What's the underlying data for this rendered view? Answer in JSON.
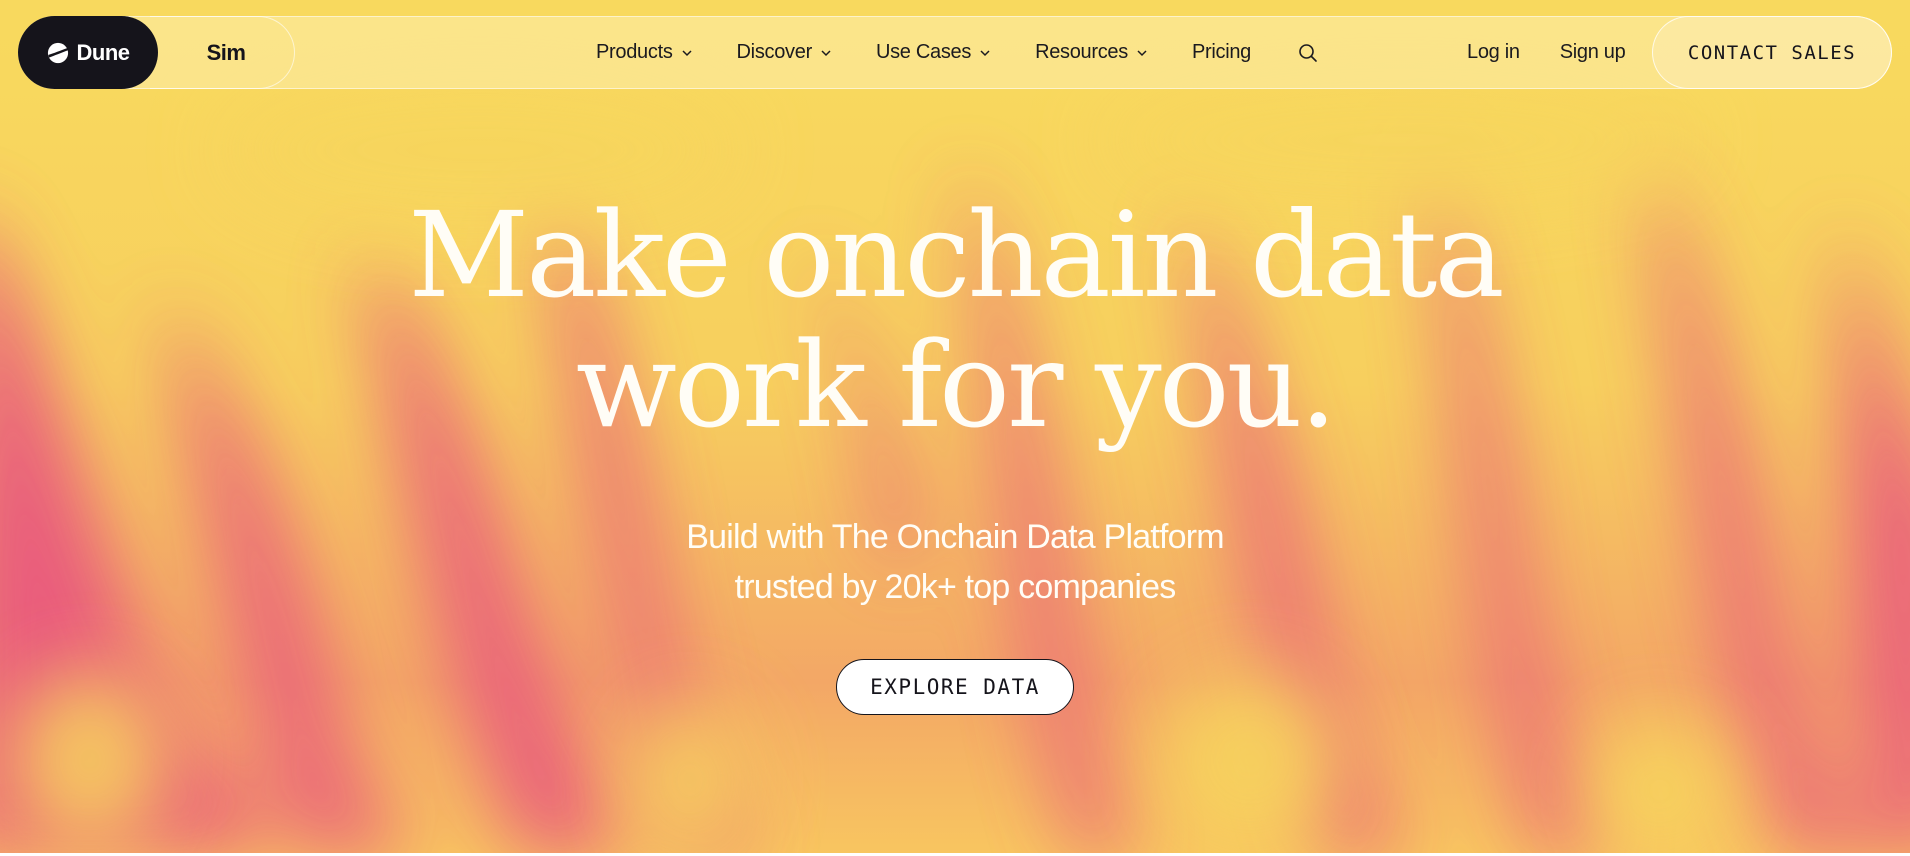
{
  "brand": {
    "name": "Dune",
    "icon": "dune-logo-icon",
    "secondary": "Sim"
  },
  "nav": {
    "items": [
      {
        "label": "Products",
        "dropdown": true
      },
      {
        "label": "Discover",
        "dropdown": true
      },
      {
        "label": "Use Cases",
        "dropdown": true
      },
      {
        "label": "Resources",
        "dropdown": true
      },
      {
        "label": "Pricing",
        "dropdown": false
      }
    ],
    "search_icon": "search-icon",
    "login": "Log in",
    "signup": "Sign up",
    "contact": "CONTACT SALES"
  },
  "hero": {
    "headline_line1": "Make onchain data",
    "headline_line2": "work for you.",
    "sub_line1": "Build with The Onchain Data Platform",
    "sub_line2": "trusted by 20k+ top companies",
    "cta": "EXPLORE DATA"
  },
  "colors": {
    "brand_dark": "#15141b",
    "bg_yellow": "#f8d95e",
    "bg_pink": "#e8557f",
    "text_light": "#fffdf6"
  }
}
